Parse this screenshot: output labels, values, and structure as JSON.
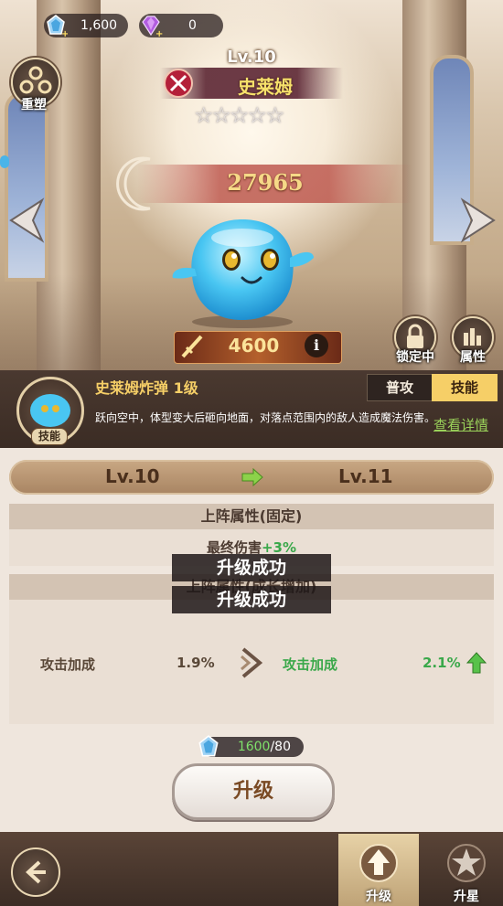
{
  "currency": {
    "crystal_amount": "1,600",
    "gem_amount": "0",
    "crystal_icon": "crystal-icon",
    "gem_icon": "purple-gem-icon"
  },
  "side_buttons": {
    "reshape_label": "重塑",
    "lock_label": "锁定中",
    "attributes_label": "属性"
  },
  "character": {
    "level": "Lv.10",
    "name": "史莱姆",
    "stars_total": 5,
    "stars_filled": 0,
    "power": "27965",
    "attack": "4600"
  },
  "skill": {
    "title": "史莱姆炸弹 1级",
    "badge": "技能",
    "description": "跃向空中，体型变大后砸向地面，对落点范围内的敌人造成魔法伤害。",
    "tab_normal": "普攻",
    "tab_skill": "技能",
    "detail_link": "查看详情"
  },
  "upgrade": {
    "level_from": "Lv.10",
    "level_to": "Lv.11",
    "fixed_section_title": "上阵属性(固定)",
    "fixed_stat_label": "最终伤害",
    "fixed_stat_value": "+3%",
    "growth_section_title": "上阵属性(成长增加)",
    "stat_name_before": "攻击加成",
    "stat_value_before": "1.9%",
    "stat_name_after": "攻击加成",
    "stat_value_after": "2.1%",
    "toast_1": "升级成功",
    "toast_2": "升级成功",
    "cost_have": "1600",
    "cost_need": "/80",
    "button_label": "升级"
  },
  "bottom_nav": {
    "upgrade_label": "升级",
    "star_label": "升星"
  },
  "colors": {
    "accent_gold": "#f6cf67",
    "green": "#4caf50",
    "panel_brown": "#3b2c24"
  }
}
